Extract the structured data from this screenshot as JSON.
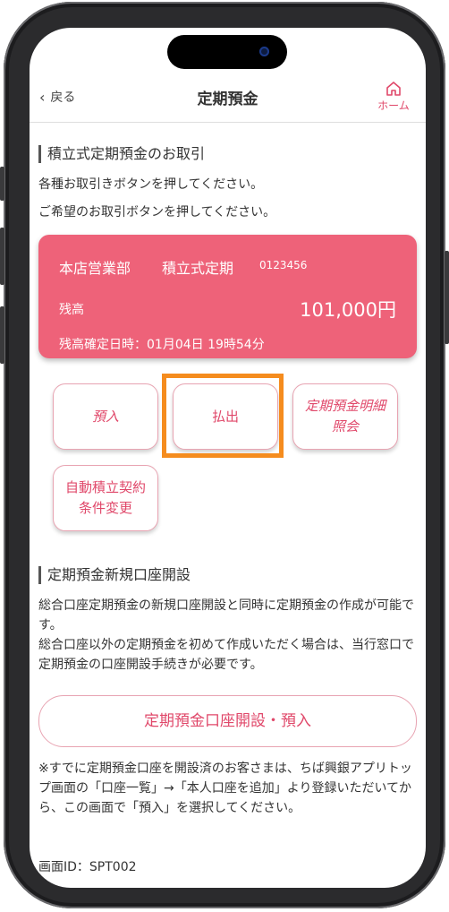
{
  "header": {
    "back_label": "戻る",
    "title": "定期預金",
    "home_label": "ホーム"
  },
  "section1": {
    "title": "積立式定期預金のお取引",
    "line1": "各種お取引きボタンを押してください。",
    "line2": "ご希望のお取引ボタンを押してください。"
  },
  "card": {
    "branch": "本店営業部",
    "type": "積立式定期",
    "account_number": "0123456",
    "balance_label": "残高",
    "balance_value": "101,000円",
    "confirmed_at": "残高確定日時：01月04日 19時54分",
    "color": "#ee6279"
  },
  "actions": {
    "deposit": "預入",
    "withdraw": "払出",
    "statement": "定期預金明細\n照会",
    "auto_contract": "自動積立契約\n条件変更"
  },
  "section2": {
    "title": "定期預金新規口座開設",
    "paragraph": "総合口座定期預金の新規口座開設と同時に定期預金の作成が可能です。\n総合口座以外の定期預金を初めて作成いただく場合は、当行窓口で定期預金の口座開設手続きが必要です。",
    "open_button": "定期預金口座開設・預入",
    "note": "※すでに定期預金口座を開設済のお客さまは、ちば興銀アプリトップ画面の「口座一覧」→「本人口座を追加」より登録いただいてから、この画面で「預入」を選択してください。"
  },
  "footer": {
    "screen_id": "画面ID：SPT002"
  },
  "colors": {
    "accent": "#e0486a",
    "highlight": "#f58c1e"
  }
}
